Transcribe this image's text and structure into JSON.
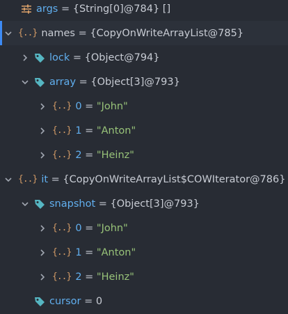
{
  "colors": {
    "background": "#282c34",
    "selection": "#2c313a",
    "accent": "#3d8bf5",
    "name": "#61afef",
    "string": "#98c379",
    "icon_orange": "#d19a66",
    "tag_teal": "#56b6c2"
  },
  "rows": [
    {
      "name": "args",
      "eq": " = ",
      "value": "{String[0]@784} []",
      "icon": "settings-sliders-icon"
    },
    {
      "name": "names",
      "eq": " = ",
      "value": "{CopyOnWriteArrayList@785}",
      "icon": "object-braces-icon",
      "expanded": true,
      "selected": true
    },
    {
      "name": "lock",
      "eq": " = ",
      "value": "{Object@794}",
      "icon": "field-tag-icon"
    },
    {
      "name": "array",
      "eq": " = ",
      "value": "{Object[3]@793}",
      "icon": "field-tag-icon",
      "expanded": true
    },
    {
      "name": "0",
      "eq": " = ",
      "value": "\"John\"",
      "icon": "object-braces-icon"
    },
    {
      "name": "1",
      "eq": " = ",
      "value": "\"Anton\"",
      "icon": "object-braces-icon"
    },
    {
      "name": "2",
      "eq": " = ",
      "value": "\"Heinz\"",
      "icon": "object-braces-icon"
    },
    {
      "name": "it",
      "eq": " = ",
      "value": "{CopyOnWriteArrayList$COWIterator@786}",
      "icon": "object-braces-icon",
      "expanded": true
    },
    {
      "name": "snapshot",
      "eq": " = ",
      "value": "{Object[3]@793}",
      "icon": "field-tag-icon",
      "expanded": true
    },
    {
      "name": "0",
      "eq": " = ",
      "value": "\"John\"",
      "icon": "object-braces-icon"
    },
    {
      "name": "1",
      "eq": " = ",
      "value": "\"Anton\"",
      "icon": "object-braces-icon"
    },
    {
      "name": "2",
      "eq": " = ",
      "value": "\"Heinz\"",
      "icon": "object-braces-icon"
    },
    {
      "name": "cursor",
      "eq": " = ",
      "value": "0",
      "icon": "field-tag-icon"
    }
  ]
}
